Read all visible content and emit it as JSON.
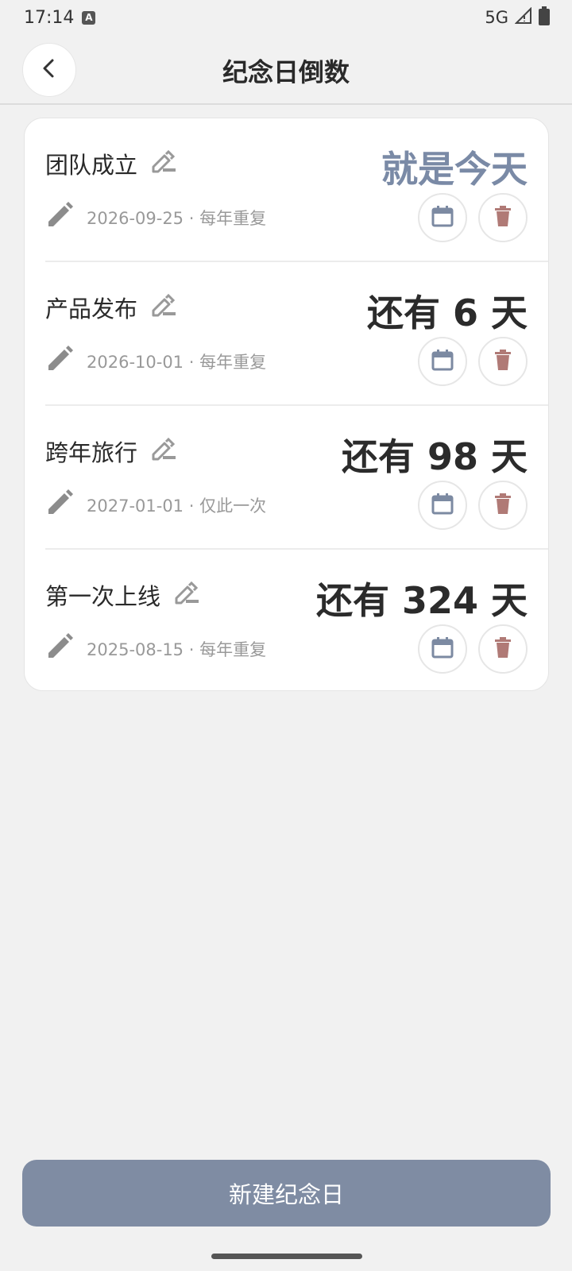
{
  "status": {
    "time": "17:14",
    "badge": "A",
    "network": "5G"
  },
  "header": {
    "title": "纪念日倒数"
  },
  "items": [
    {
      "name": "团队成立",
      "meta": "2026-09-25 · 每年重复",
      "countdown": "就是今天",
      "is_today": true
    },
    {
      "name": "产品发布",
      "meta": "2026-10-01 · 每年重复",
      "countdown": "还有 6 天",
      "is_today": false
    },
    {
      "name": "跨年旅行",
      "meta": "2027-01-01 · 仅此一次",
      "countdown": "还有 98 天",
      "is_today": false
    },
    {
      "name": "第一次上线",
      "meta": "2025-08-15 · 每年重复",
      "countdown": "还有 324 天",
      "is_today": false
    }
  ],
  "footer": {
    "new_button": "新建纪念日"
  },
  "colors": {
    "accent": "#7f8ca3",
    "today": "#7a8aa6",
    "delete": "#b07a76",
    "calendar": "#7c8aa2"
  },
  "icons": {
    "back": "chevron-left-icon",
    "title_edit": "pencil-outline-icon",
    "meta_edit": "pencil-icon",
    "calendar": "calendar-icon",
    "delete": "trash-icon"
  }
}
